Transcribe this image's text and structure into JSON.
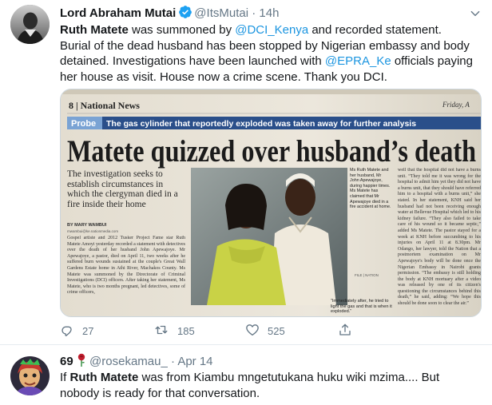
{
  "tweet": {
    "author_name": "Lord Abraham Mutai",
    "handle": "@ItsMutai",
    "separator": "·",
    "time": "14h",
    "text_parts": {
      "p1_bold": "Ruth Matete",
      "p2": " was summoned by ",
      "p3_link": "@DCI_Kenya",
      "p4": " and recorded statement. Burial of the dead husband has been stopped by Nigerian embassy and body detained. Investigations have been launched with ",
      "p5_link": "@EPRA_Ke",
      "p6": " officials paying her house as visit. House now a crime scene. Thank you DCI."
    },
    "media": {
      "page_label": "8 | National News",
      "date_label": "Friday, A",
      "probe_tag": "Probe",
      "probe_text": "The gas cylinder that reportedly exploded was taken away for further analysis",
      "headline": "Matete quizzed over husband’s death",
      "deck": "The investigation seeks to establish circumstances in which the clergyman died in a fire inside their home",
      "byline": "BY MARY WAMBUI",
      "email": "mwambui@ke.nationmedia.com",
      "col1": "Gospel artiste and 2012 Tusker Project Fame star Ruth Matete Amoyi yesterday recorded a statement with detectives over the death of her husband John Apewajoye. Mr Apewajoye, a pastor, died on April 11, two weeks after he suffered burn wounds sustained at the couple's Great Wall Gardens Estate home in Athi River, Machakos County. Ms Matete was summoned by the Directorate of Criminal Investigations (DCI) officers. After taking her statement, Ms Matete, who is two months pregnant, led detectives, some of crime officers,",
      "caption": "Ms Ruth Matete and her husband, Mr John Apewajoye, during happier times. Ms Matete has claimed that Mr Apewajoye died in a fire accident at home.",
      "photo_credit": "FILE | NATION",
      "quote": "“Immediately after, he tried to light the gas and that is when it exploded.”",
      "col3": "well that the hospital did not have a burns unit. “They told me it was wrong for the hospital to admit him yet they did not have a burns unit, that they should have referred him to a hospital with a burns unit,” she stated. In her statement, KNH said her husband had not been receiving enough water at Bellevue Hospital which led to his kidney failure. “They also failed to take care of his wound so it became septic,” added Ms Matete. The pastor stayed for a week at KNH before succumbing to his injuries on April 11 at 8.30pm. Mr Odango, her lawyer, told the Nation that a postmortem examination on Mr Apewajoye's body will be done once the Nigerian Embassy in Nairobi grants permission. “The embassy is still holding the body at KNH mortuary after a video was released by one of its citizen's questioning the circumstances behind this death,” he said, adding: “We hope this should be done soon to clear the air.”"
    },
    "actions": {
      "reply_count": "27",
      "retweet_count": "185",
      "like_count": "525"
    }
  },
  "reply": {
    "author_name": "69",
    "handle": "@rosekamau_",
    "separator": "·",
    "time": "Apr 14",
    "text_prefix": "If ",
    "text_bold": "Ruth Matete",
    "text_rest": " was from Kiambu mngetutukana huku wiki mzima.... But nobody is ready for that conversation."
  },
  "icons": {
    "verified": "verified-badge-icon",
    "more": "chevron-down-icon",
    "reply": "reply-icon",
    "retweet": "retweet-icon",
    "like": "heart-icon",
    "share": "share-icon",
    "rose": "rose-emoji-icon"
  },
  "colors": {
    "link": "#1b95e0",
    "muted": "#657786",
    "probe_bar": "#2a4f8a",
    "headline": "#1b1b1b",
    "verified": "#1da1f2"
  }
}
